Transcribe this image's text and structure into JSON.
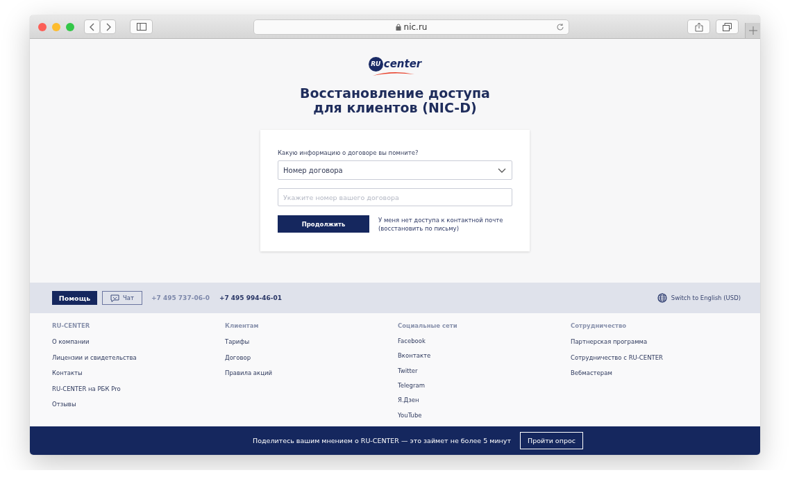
{
  "browser": {
    "address": "nic.ru"
  },
  "logo": {
    "badge": "RU",
    "text": "center"
  },
  "title": "Восстановление доступа\nдля клиентов (NIC-D)",
  "form": {
    "question": "Какую информацию о договоре вы помните?",
    "select": {
      "value": "Номер договора"
    },
    "input": {
      "placeholder": "Укажите номер вашего договора"
    },
    "submit": "Продолжить",
    "link": "У меня нет доступа к контактной почте\n(восстановить по письму)"
  },
  "footer_bar": {
    "help": "Помощь",
    "chat": "Чат",
    "phones": [
      {
        "number": "+7 495 737-06-0",
        "faded": true
      },
      {
        "number": "+7 495 994-46-01",
        "faded": false
      }
    ],
    "language": "Switch to English (USD)"
  },
  "footer_columns": [
    {
      "heading": "RU-CENTER",
      "links": [
        "О компании",
        "Лицензии и свидетельства",
        "Контакты",
        "RU-CENTER на РБК Pro",
        "Отзывы"
      ]
    },
    {
      "heading": "Клиентам",
      "links": [
        "Тарифы",
        "Договор",
        "Правила акций"
      ]
    },
    {
      "heading": "Социальные сети",
      "links": [
        "Facebook",
        "Вконтакте",
        "Twitter",
        "Telegram",
        "Я.Дзен",
        "YouTube"
      ]
    },
    {
      "heading": "Сотрудничество",
      "links": [
        "Партнерская программа",
        "Сотрудничество с RU-CENTER",
        "Вебмастерам"
      ]
    }
  ],
  "banner": {
    "text": "Поделитесь вашим мнением о RU-CENTER — это займет не более 5 минут",
    "button": "Пройти опрос"
  }
}
